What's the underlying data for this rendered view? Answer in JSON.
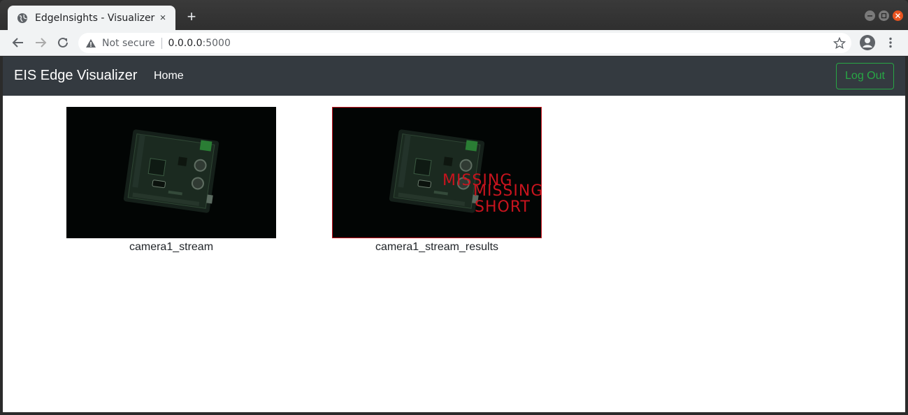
{
  "browser": {
    "tab_title": "EdgeInsights - Visualizer",
    "tab_close": "×",
    "new_tab": "+",
    "address": {
      "security_label": "Not secure",
      "host": "0.0.0.0",
      "port": ":5000"
    }
  },
  "navbar": {
    "brand": "EIS Edge Visualizer",
    "home_link": "Home",
    "logout_label": "Log Out",
    "logout_color": "#28a745",
    "background": "#343a40"
  },
  "streams": [
    {
      "label": "camera1_stream"
    },
    {
      "label": "camera1_stream_results",
      "annotations": [
        "MISSING",
        "MISSING",
        "SHORT"
      ],
      "annotation_color": "#c8141e"
    }
  ]
}
